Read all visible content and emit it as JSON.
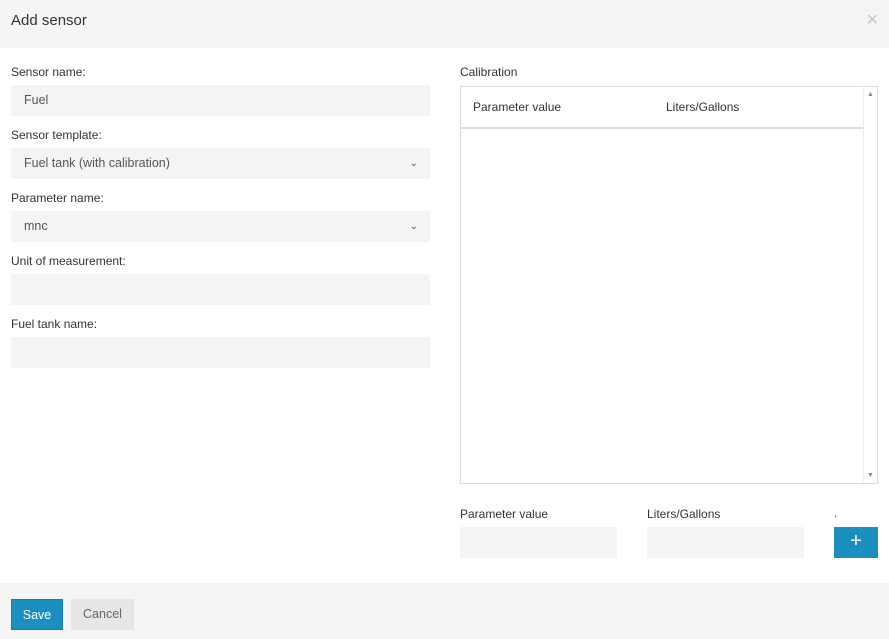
{
  "dialog": {
    "title": "Add sensor",
    "close_icon": "✕"
  },
  "form": {
    "sensor_name": {
      "label": "Sensor name:",
      "value": "Fuel"
    },
    "sensor_template": {
      "label": "Sensor template:",
      "value": "Fuel tank (with calibration)"
    },
    "parameter_name": {
      "label": "Parameter name:",
      "value": "mnc"
    },
    "unit_of_measurement": {
      "label": "Unit of measurement:",
      "value": ""
    },
    "fuel_tank_name": {
      "label": "Fuel tank name:",
      "value": ""
    },
    "chevron_icon": "⌄"
  },
  "calibration": {
    "label": "Calibration",
    "columns": [
      "Parameter value",
      "Liters/Gallons"
    ],
    "rows": [],
    "scroll_up": "▲",
    "scroll_down": "▼",
    "new_row": {
      "parameter_label": "Parameter value",
      "parameter_value": "",
      "liters_label": "Liters/Gallons",
      "liters_value": "",
      "dot": ".",
      "add_icon": "+"
    }
  },
  "footer": {
    "save_label": "Save",
    "cancel_label": "Cancel"
  },
  "colors": {
    "accent": "#1b90c0",
    "field_bg": "#f4f4f4",
    "header_bg": "#f5f5f5"
  }
}
